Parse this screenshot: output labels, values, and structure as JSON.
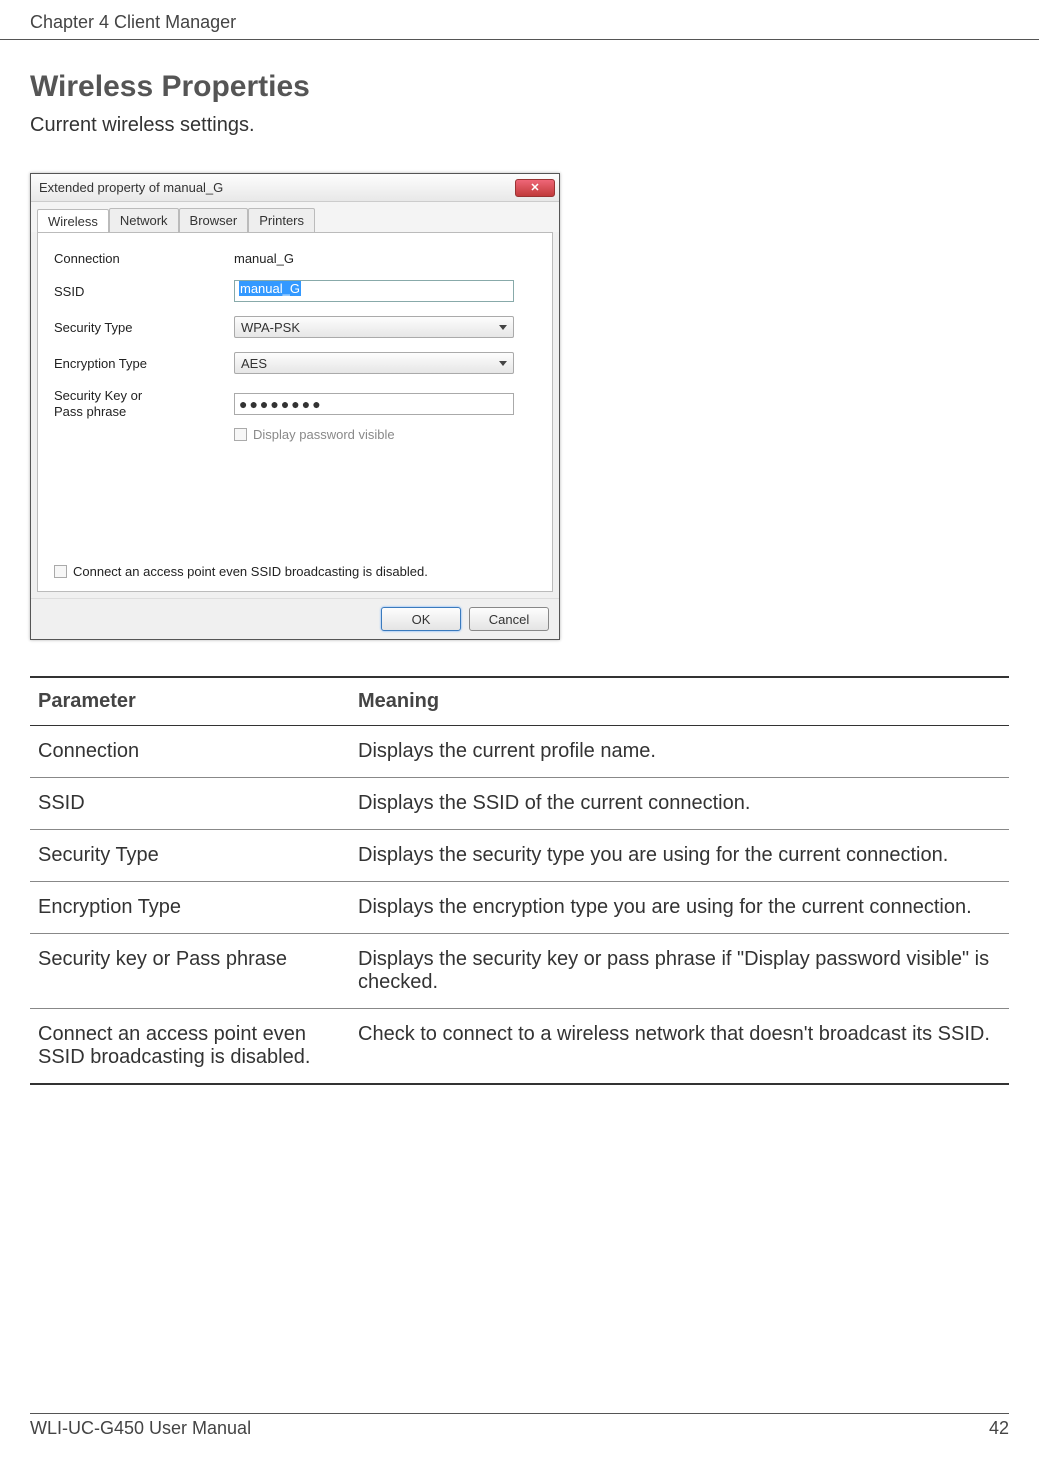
{
  "header": {
    "chapter": "Chapter 4  Client Manager"
  },
  "section": {
    "title": "Wireless Properties",
    "desc": "Current wireless settings."
  },
  "dialog": {
    "title": "Extended property of manual_G",
    "tabs": [
      "Wireless",
      "Network",
      "Browser",
      "Printers"
    ],
    "labels": {
      "connection": "Connection",
      "ssid": "SSID",
      "security_type": "Security Type",
      "encryption_type": "Encryption Type",
      "key": "Security Key or\nPass phrase"
    },
    "values": {
      "connection": "manual_G",
      "ssid": "manual_G",
      "security_type": "WPA-PSK",
      "encryption_type": "AES",
      "password_mask": "●●●●●●●●"
    },
    "display_password_label": "Display password visible",
    "connect_hidden_label": "Connect an access point even SSID broadcasting is disabled.",
    "buttons": {
      "ok": "OK",
      "cancel": "Cancel"
    }
  },
  "table": {
    "head": {
      "param": "Parameter",
      "meaning": "Meaning"
    },
    "rows": [
      {
        "param": "Connection",
        "meaning": "Displays the current profile name."
      },
      {
        "param": "SSID",
        "meaning": "Displays the SSID of the current connection."
      },
      {
        "param": "Security Type",
        "meaning": "Displays the security type you are using for the current connection."
      },
      {
        "param": "Encryption Type",
        "meaning": "Displays the encryption type you are using for the current connection."
      },
      {
        "param": "Security key or Pass phrase",
        "meaning": "Displays the security key or pass phrase if \"Display password visible\" is checked."
      },
      {
        "param": "Connect an access point even SSID broadcasting is disabled.",
        "meaning": "Check to connect to a wireless network that doesn't broadcast its SSID."
      }
    ]
  },
  "footer": {
    "manual": "WLI-UC-G450 User Manual",
    "page": "42"
  }
}
